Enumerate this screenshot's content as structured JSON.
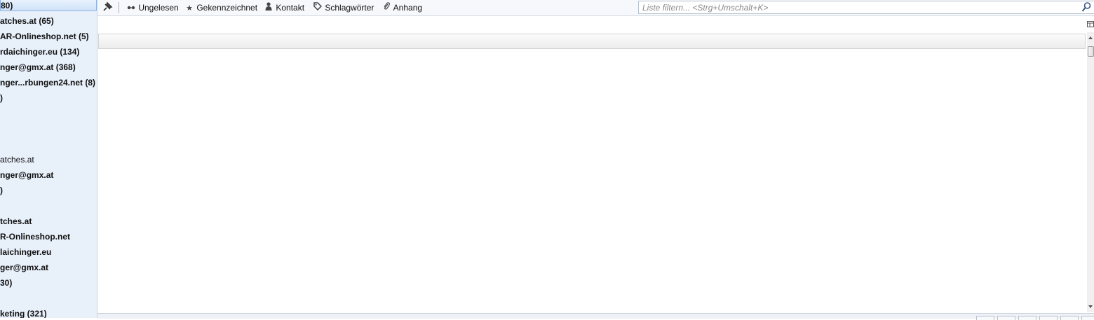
{
  "folders": [
    {
      "label": "80)"
    },
    {
      "label": "atches.at (65)"
    },
    {
      "label": "AR-Onlineshop.net (5)"
    },
    {
      "label": "rdaichinger.eu (134)"
    },
    {
      "label": "nger@gmx.at (368)"
    },
    {
      "label": "nger...rbungen24.net (8)"
    },
    {
      "label": ")"
    },
    {
      "label": "atches.at"
    },
    {
      "label": "nger@gmx.at"
    },
    {
      "label": ")"
    },
    {
      "label": "tches.at"
    },
    {
      "label": "R-Onlineshop.net"
    },
    {
      "label": "laichinger.eu"
    },
    {
      "label": "ger@gmx.at"
    },
    {
      "label": "30)"
    },
    {
      "label": "keting (321)"
    }
  ],
  "toolbar": {
    "unread": "Ungelesen",
    "starred": "Gekennzeichnet",
    "contact": "Kontakt",
    "tags": "Schlagwörter",
    "attachment": "Anhang"
  },
  "search": {
    "placeholder": "Liste filtern... <Strg+Umschalt+K>"
  },
  "colors": {
    "folder_pane_bg": "#e8f0fa",
    "selection": "#cfe2f8"
  }
}
